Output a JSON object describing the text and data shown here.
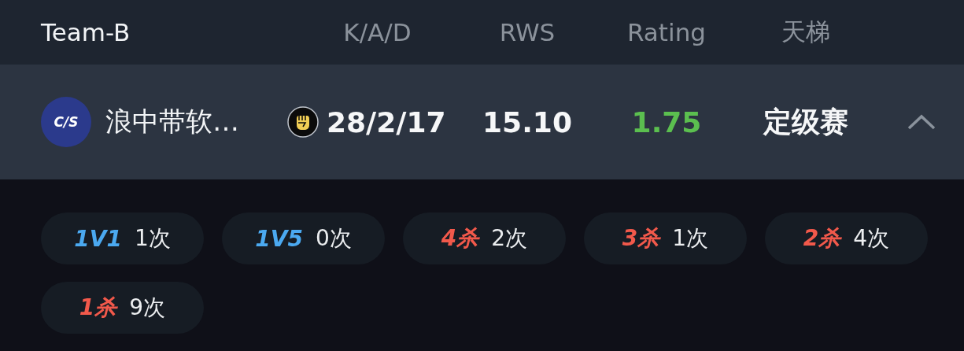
{
  "header": {
    "team": "Team-B",
    "columns": [
      "K/A/D",
      "RWS",
      "Rating",
      "天梯"
    ]
  },
  "player": {
    "logo": "C/S",
    "name": "浪中带软…",
    "kad": "28/2/17",
    "rws": "15.10",
    "rating": "1.75",
    "ladder": "定级赛",
    "expanded": true
  },
  "achievements": [
    {
      "kind": "clutch",
      "label": "1V1",
      "count": "1次"
    },
    {
      "kind": "clutch",
      "label": "1V5",
      "count": "0次"
    },
    {
      "kind": "kill",
      "label": "4杀",
      "count": "2次"
    },
    {
      "kind": "kill",
      "label": "3杀",
      "count": "1次"
    },
    {
      "kind": "kill",
      "label": "2杀",
      "count": "4次"
    },
    {
      "kind": "kill",
      "label": "1杀",
      "count": "9次"
    }
  ]
}
